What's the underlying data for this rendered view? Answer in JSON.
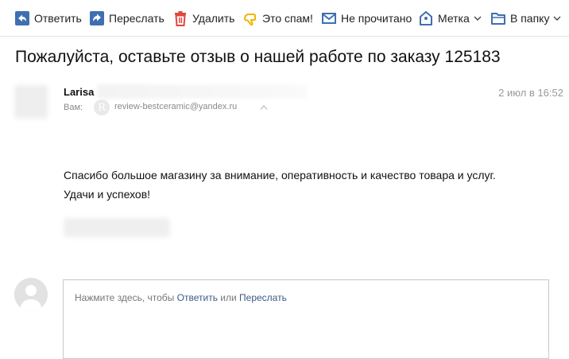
{
  "toolbar": {
    "reply": "Ответить",
    "forward": "Переслать",
    "delete": "Удалить",
    "spam": "Это спам!",
    "unread": "Не прочитано",
    "label": "Метка",
    "folder": "В папку"
  },
  "icons": {
    "reply": "reply-icon",
    "forward": "forward-icon",
    "delete": "trash-icon",
    "spam": "thumbs-down-icon",
    "unread": "envelope-icon",
    "label": "tag-icon",
    "folder": "folder-icon"
  },
  "colors": {
    "toolbar_icon": "#3f6fb1",
    "delete_icon": "#e0473e",
    "spam_icon": "#f0b400",
    "link": "#3b5b84"
  },
  "message": {
    "subject": "Пожалуйста, оставьте отзыв о нашей работе по заказу 125183",
    "sender_name": "Larisa",
    "date": "2 июл в 16:52",
    "to_label": "Вам:",
    "to_avatar_letter": "R",
    "to_email": "review-bestceramic@yandex.ru",
    "body_line1": "Спасибо большое магазину за внимание, оперативность и качество товара и услуг.",
    "body_line2": "Удачи и успехов!"
  },
  "reply": {
    "hint_prefix": "Нажмите здесь, чтобы ",
    "hint_reply": "Ответить",
    "hint_or": " или ",
    "hint_forward": "Переслать"
  }
}
